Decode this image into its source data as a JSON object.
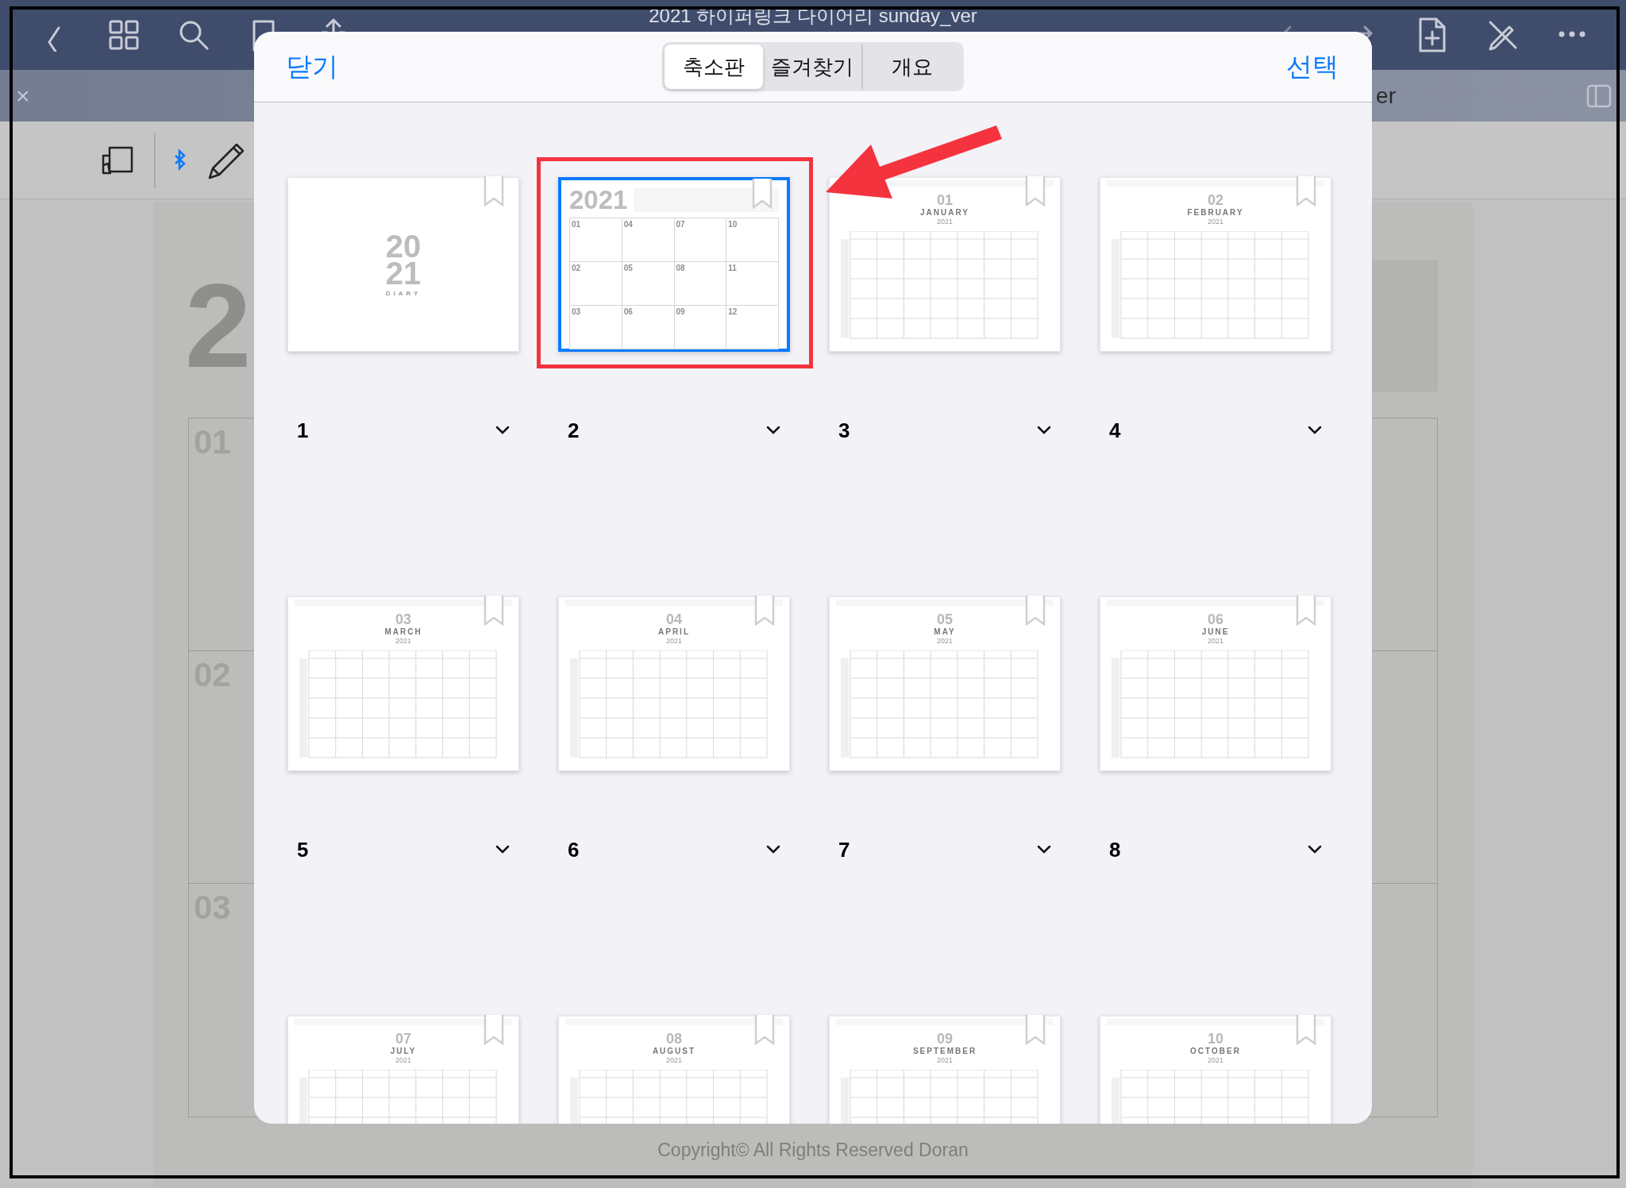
{
  "toolbar": {
    "title": "2021 하이퍼링크 다이어리 sunday_ver"
  },
  "tab_bar": {
    "close": "×",
    "tab_title": "er"
  },
  "document": {
    "year_digit": "2",
    "sections": [
      "01",
      "02",
      "03"
    ],
    "footer": "Copyright© All Rights Reserved Doran"
  },
  "thumbnails_panel": {
    "close": "닫기",
    "select": "선택",
    "segments": [
      {
        "label": "축소판",
        "selected": true
      },
      {
        "label": "즐겨찾기",
        "selected": false
      },
      {
        "label": "개요",
        "selected": false
      }
    ],
    "pages": [
      {
        "kind": "cover",
        "number": "1",
        "selected": false,
        "title_lines": [
          "20",
          "21"
        ],
        "subtitle": "DIARY"
      },
      {
        "kind": "index",
        "number": "2",
        "selected": true,
        "title": "2021",
        "cells": [
          "01",
          "04",
          "07",
          "10",
          "02",
          "05",
          "08",
          "11",
          "03",
          "06",
          "09",
          "12"
        ]
      },
      {
        "kind": "month",
        "number": "3",
        "selected": false,
        "big_number": "01",
        "month": "JANUARY",
        "year": "2021"
      },
      {
        "kind": "month",
        "number": "4",
        "selected": false,
        "big_number": "02",
        "month": "FEBRUARY",
        "year": "2021"
      },
      {
        "kind": "month",
        "number": "5",
        "selected": false,
        "big_number": "03",
        "month": "MARCH",
        "year": "2021"
      },
      {
        "kind": "month",
        "number": "6",
        "selected": false,
        "big_number": "04",
        "month": "APRIL",
        "year": "2021"
      },
      {
        "kind": "month",
        "number": "7",
        "selected": false,
        "big_number": "05",
        "month": "MAY",
        "year": "2021"
      },
      {
        "kind": "month",
        "number": "8",
        "selected": false,
        "big_number": "06",
        "month": "JUNE",
        "year": "2021"
      },
      {
        "kind": "month",
        "selected": false,
        "big_number": "07",
        "month": "JULY",
        "year": "2021"
      },
      {
        "kind": "month",
        "selected": false,
        "big_number": "08",
        "month": "AUGUST",
        "year": "2021"
      },
      {
        "kind": "month",
        "selected": false,
        "big_number": "09",
        "month": "SEPTEMBER",
        "year": "2021"
      },
      {
        "kind": "month",
        "selected": false,
        "big_number": "10",
        "month": "OCTOBER",
        "year": "2021"
      }
    ]
  }
}
